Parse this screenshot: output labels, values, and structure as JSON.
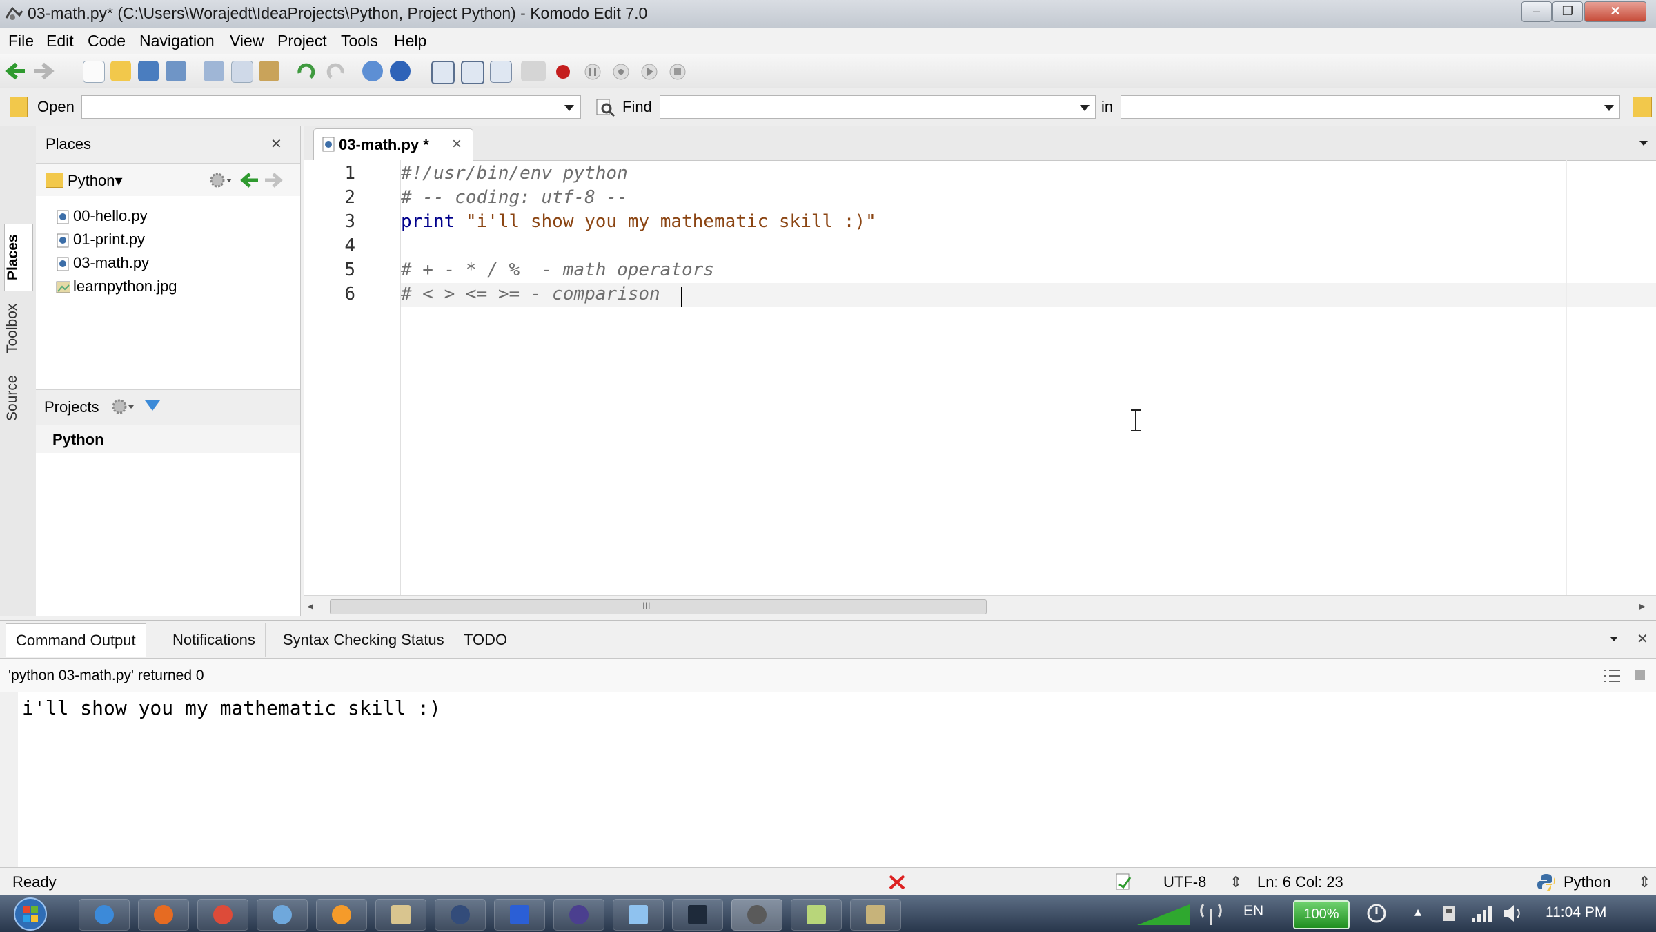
{
  "window": {
    "title": "03-math.py* (C:\\Users\\Worajedt\\IdeaProjects\\Python, Project Python) - Komodo Edit 7.0",
    "minimize_glyph": "–",
    "restore_glyph": "❐",
    "close_glyph": "✕"
  },
  "menu": [
    "File",
    "Edit",
    "Code",
    "Navigation",
    "View",
    "Project",
    "Tools",
    "Help"
  ],
  "quickbar": {
    "open_label": "Open",
    "find_label": "Find",
    "in_label": "in",
    "open_value": "",
    "find_value": "",
    "in_value": ""
  },
  "side_tabs": [
    "Places",
    "Toolbox",
    "Source"
  ],
  "places": {
    "title": "Places",
    "close_glyph": "✕",
    "folder": "Python▾",
    "files": [
      "00-hello.py",
      "01-print.py",
      "03-math.py",
      "learnpython.jpg"
    ],
    "projects_label": "Projects",
    "project_name": "Python"
  },
  "editor": {
    "tab_label": "03-math.py *",
    "tab_close": "×",
    "line_numbers": [
      "1",
      "2",
      "3",
      "4",
      "5",
      "6"
    ],
    "lines": {
      "l1": "#!/usr/bin/env python",
      "l2": "# -- coding: utf-8 --",
      "l3_kw": "print",
      "l3_str": "\"i'll show you my mathematic skill :)\"",
      "l5": "# + - * / %  - math operators",
      "l6": "# < > <= >= - comparison"
    },
    "hscroll_grip": "III"
  },
  "bottom_panel": {
    "tabs": [
      "Command Output",
      "Notifications",
      "Syntax Checking Status",
      "TODO"
    ],
    "command": "'python 03-math.py' returned 0",
    "output": "i'll show you my mathematic skill :)",
    "close_glyph": "✕"
  },
  "status": {
    "state": "Ready",
    "encoding": "UTF-8",
    "position": "Ln: 6 Col: 23",
    "language": "Python"
  },
  "taskbar": {
    "language": "EN",
    "battery": "100%",
    "time": "11:04 PM"
  },
  "colors": {
    "accent": "#2a6fd1",
    "keyword": "#00008b",
    "string": "#8b4513",
    "comment": "#6e6e6e",
    "battery_green": "#2fa82f"
  }
}
